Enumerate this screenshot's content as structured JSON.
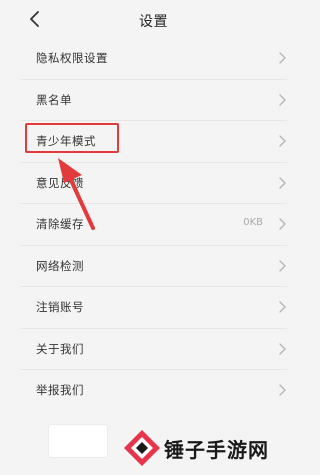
{
  "header": {
    "title": "设置"
  },
  "settings": {
    "items": [
      {
        "label": "隐私权限设置"
      },
      {
        "label": "黑名单"
      },
      {
        "label": "青少年模式"
      },
      {
        "label": "意见反馈"
      },
      {
        "label": "清除缓存",
        "value": "0KB"
      },
      {
        "label": "网络检测"
      },
      {
        "label": "注销账号"
      },
      {
        "label": "关于我们"
      },
      {
        "label": "举报我们"
      }
    ]
  },
  "annotation": {
    "color": "#e33b3b"
  },
  "watermark": {
    "text": "锤子手游网"
  }
}
